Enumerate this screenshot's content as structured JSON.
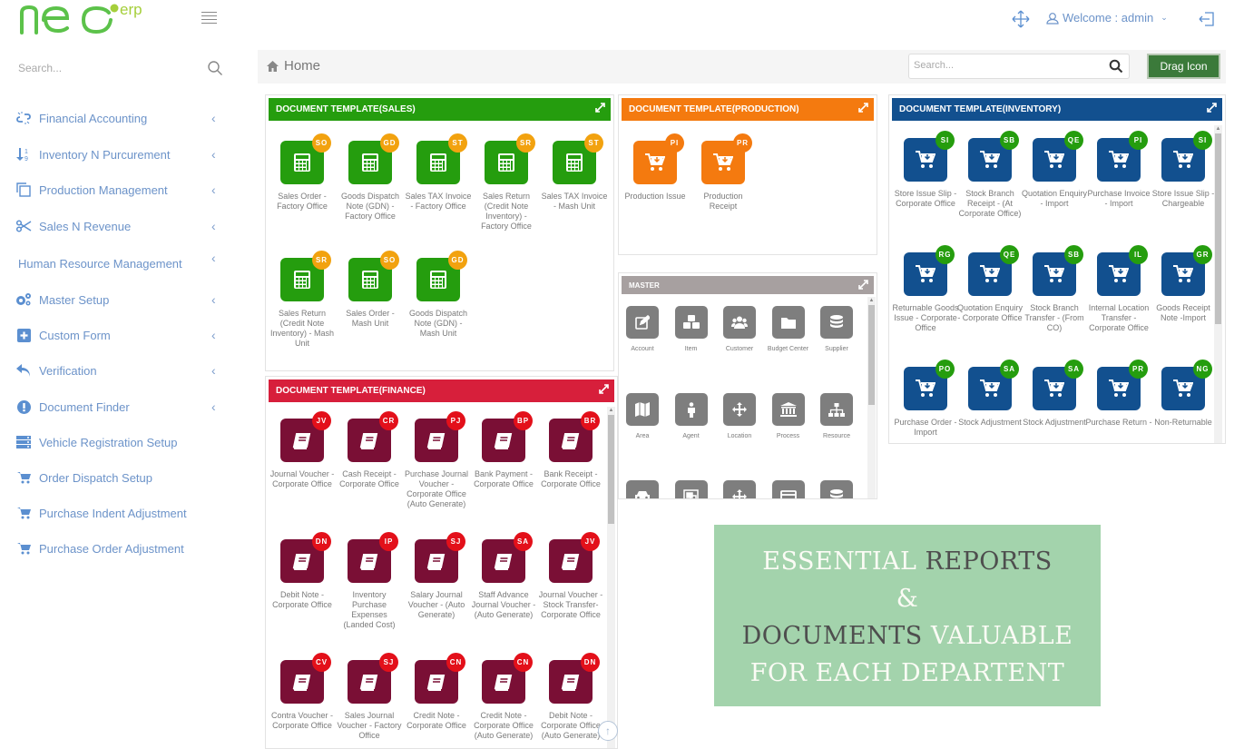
{
  "header": {
    "logo_text": "neo",
    "logo_sup": "erp",
    "welcome_label": "Welcome : admin",
    "icons": {
      "menu": "hamburger-icon",
      "move": "move-arrows-icon",
      "user": "user-icon",
      "logout": "logout-icon"
    }
  },
  "sidebar": {
    "search_placeholder": "Search...",
    "items": [
      {
        "label": "Financial Accounting",
        "icon": "chain-broken-icon",
        "has_submenu": true
      },
      {
        "label": "Inventory N Purcurement",
        "icon": "sort-numeric-icon",
        "has_submenu": true
      },
      {
        "label": "Production Management",
        "icon": "copy-icon",
        "has_submenu": true
      },
      {
        "label": "Sales N Revenue",
        "icon": "scissors-icon",
        "has_submenu": true
      },
      {
        "label": "Human Resource Management",
        "icon": "",
        "has_submenu": true
      },
      {
        "label": "Master Setup",
        "icon": "gears-icon",
        "has_submenu": true
      },
      {
        "label": "Custom Form",
        "icon": "plus-square-icon",
        "has_submenu": true
      },
      {
        "label": "Verification",
        "icon": "reply-icon",
        "has_submenu": true
      },
      {
        "label": "Document Finder",
        "icon": "exclamation-circle-icon",
        "has_submenu": true
      },
      {
        "label": "Vehicle Registration Setup",
        "icon": "server-icon",
        "has_submenu": false
      },
      {
        "label": "Order Dispatch Setup",
        "icon": "cart-icon",
        "has_submenu": false
      },
      {
        "label": "Purchase Indent Adjustment",
        "icon": "cart-icon",
        "has_submenu": false
      },
      {
        "label": "Purchase Order Adjustment",
        "icon": "cart-icon",
        "has_submenu": false
      }
    ]
  },
  "topbar": {
    "breadcrumb": "Home",
    "search_placeholder": "Search...",
    "drag_button": "Drag Icon"
  },
  "panels": {
    "sales": {
      "title": "DOCUMENT TEMPLATE(SALES)",
      "header_color": "#259d0e",
      "tile_color": "#259d0e",
      "badge_color": "#f2a20f",
      "tiles": [
        {
          "badge": "SO",
          "label": "Sales Order - Factory Office"
        },
        {
          "badge": "GD",
          "label": "Goods Dispatch Note (GDN) - Factory Office"
        },
        {
          "badge": "ST",
          "label": "Sales TAX Invoice - Factory Office"
        },
        {
          "badge": "SR",
          "label": "Sales Return (Credit Note Inventory) - Factory Office"
        },
        {
          "badge": "ST",
          "label": "Sales TAX Invoice - Mash Unit"
        },
        {
          "badge": "SR",
          "label": "Sales Return (Credit Note Inventory) - Mash Unit"
        },
        {
          "badge": "SO",
          "label": "Sales Order - Mash Unit"
        },
        {
          "badge": "GD",
          "label": "Goods Dispatch Note (GDN) - Mash Unit"
        }
      ]
    },
    "production": {
      "title": "DOCUMENT TEMPLATE(PRODUCTION)",
      "header_color": "#f47a0f",
      "tile_color": "#f47a0f",
      "badge_color": "#f47a0f",
      "tiles": [
        {
          "badge": "PI",
          "label": "Production Issue"
        },
        {
          "badge": "PR",
          "label": "Production Receipt"
        }
      ]
    },
    "inventory": {
      "title": "DOCUMENT TEMPLATE(INVENTORY)",
      "header_color": "#12508f",
      "tile_color": "#12508f",
      "badge_color": "#259d0e",
      "tiles": [
        {
          "badge": "SI",
          "label": "Store Issue Slip - Corporate Office"
        },
        {
          "badge": "SB",
          "label": "Stock Branch Receipt - (At Corporate Office)"
        },
        {
          "badge": "QE",
          "label": "Quotation Enquiry - Import"
        },
        {
          "badge": "PI",
          "label": "Purchase Invoice - Import"
        },
        {
          "badge": "SI",
          "label": "Store Issue Slip - Chargeable"
        },
        {
          "badge": "RG",
          "label": "Returnable Goods Issue - Corporate Office"
        },
        {
          "badge": "QE",
          "label": "Quotation Enquiry - Corporate Office"
        },
        {
          "badge": "SB",
          "label": "Stock Branch Transfer - (From CO)"
        },
        {
          "badge": "IL",
          "label": "Internal Location Transfer - Corporate Office"
        },
        {
          "badge": "GR",
          "label": "Goods Receipt Note -Import"
        },
        {
          "badge": "PO",
          "label": "Purchase Order - Import"
        },
        {
          "badge": "SA",
          "label": "Stock Adjustment"
        },
        {
          "badge": "SA",
          "label": "Stock Adjustment"
        },
        {
          "badge": "PR",
          "label": "Purchase Return -"
        },
        {
          "badge": "NG",
          "label": "Non-Returnable"
        }
      ]
    },
    "master": {
      "title": "MASTER",
      "header_color": "#a7a0a0",
      "tiles": [
        {
          "label": "Account",
          "icon": "edit-icon"
        },
        {
          "label": "Item",
          "icon": "cubes-icon"
        },
        {
          "label": "Customer",
          "icon": "users-icon"
        },
        {
          "label": "Budget Center",
          "icon": "folder-icon"
        },
        {
          "label": "Supplier",
          "icon": "database-icon"
        },
        {
          "label": "Area",
          "icon": "map-icon"
        },
        {
          "label": "Agent",
          "icon": "person-icon"
        },
        {
          "label": "Location",
          "icon": "move-arrows-icon"
        },
        {
          "label": "Process",
          "icon": "bank-icon"
        },
        {
          "label": "Resource",
          "icon": "sitemap-icon"
        },
        {
          "label": "",
          "icon": "car-icon"
        },
        {
          "label": "",
          "icon": "object-group-icon"
        },
        {
          "label": "",
          "icon": "move-arrows-icon"
        },
        {
          "label": "",
          "icon": "credit-card-icon"
        },
        {
          "label": "",
          "icon": "database-icon"
        }
      ]
    },
    "finance": {
      "title": "DOCUMENT TEMPLATE(FINANCE)",
      "header_color": "#d71f3b",
      "tile_color": "#7a0f35",
      "badge_color": "#e3101a",
      "tiles": [
        {
          "badge": "JV",
          "label": "Journal Voucher - Corporate Office"
        },
        {
          "badge": "CR",
          "label": "Cash Receipt - Corporate Office"
        },
        {
          "badge": "PJ",
          "label": "Purchase Journal Voucher - Corporate Office (Auto Generate)"
        },
        {
          "badge": "BP",
          "label": "Bank Payment - Corporate Office"
        },
        {
          "badge": "BR",
          "label": "Bank Receipt - Corporate Office"
        },
        {
          "badge": "DN",
          "label": "Debit Note - Corporate Office"
        },
        {
          "badge": "IP",
          "label": "Inventory Purchase Expenses (Landed Cost)"
        },
        {
          "badge": "SJ",
          "label": "Salary Journal Voucher - (Auto Generate)"
        },
        {
          "badge": "SA",
          "label": "Staff Advance Journal Voucher - (Auto Generate)"
        },
        {
          "badge": "JV",
          "label": "Journal Voucher - Stock Transfer- Corporate Office"
        },
        {
          "badge": "CV",
          "label": "Contra Voucher - Corporate Office"
        },
        {
          "badge": "SJ",
          "label": "Sales Journal Voucher - Factory Office"
        },
        {
          "badge": "CN",
          "label": "Credit Note - Corporate Office"
        },
        {
          "badge": "CN",
          "label": "Credit Note - Corporate Office (Auto Generate)"
        },
        {
          "badge": "DN",
          "label": "Debit Note - Corporate Office (Auto Generate)"
        }
      ]
    }
  },
  "promo": {
    "line1_a": "ESSENTIAL",
    "line1_b": "REPORTS",
    "line2": "&",
    "line3_a": "DOCUMENTS",
    "line3_b": "VALUABLE",
    "line4": "FOR EACH DEPARTENT",
    "background": "#a3d3ac"
  }
}
